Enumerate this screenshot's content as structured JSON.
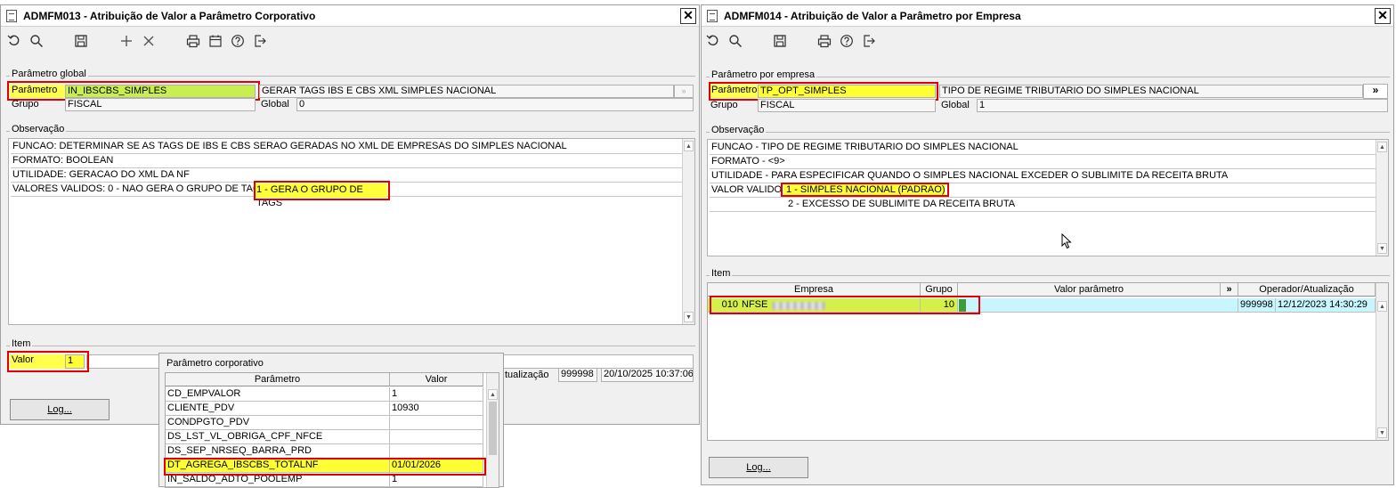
{
  "left_window": {
    "title": "ADMFM013 - Atribuição de Valor a Parâmetro Corporativo",
    "close_label": "✕",
    "param_group": {
      "title": "Parâmetro global",
      "param_label": "Parâmetro",
      "param_value": "IN_IBSCBS_SIMPLES",
      "param_desc": "GERAR TAGS IBS E CBS XML SIMPLES NACIONAL",
      "grupo_label": "Grupo",
      "grupo_value": "FISCAL",
      "global_label": "Global",
      "global_value": "0"
    },
    "obs_group": {
      "title": "Observação",
      "lines": [
        "FUNCAO: DETERMINAR SE AS TAGS DE IBS E CBS SERAO GERADAS NO XML DE EMPRESAS DO SIMPLES NACIONAL",
        "FORMATO: BOOLEAN",
        "UTILIDADE: GERACAO DO XML DA NF",
        "VALORES VALIDOS: 0 - NAO GERA O GRUPO DE TAGS"
      ],
      "highlight": "1 - GERA O GRUPO DE TAGS"
    },
    "item_group": {
      "title": "Item",
      "valor_label": "Valor",
      "valor_value": "1",
      "atualizacao_label": "tualização",
      "operador_value": "999998",
      "data_value": "20/10/2025 10:37:06"
    },
    "log_button": "Log..."
  },
  "popup": {
    "title": "Parâmetro corporativo",
    "col_param": "Parâmetro",
    "col_valor": "Valor",
    "rows": [
      {
        "param": "CD_EMPVALOR",
        "valor": "1"
      },
      {
        "param": "CLIENTE_PDV",
        "valor": "10930"
      },
      {
        "param": "CONDPGTO_PDV",
        "valor": ""
      },
      {
        "param": "DS_LST_VL_OBRIGA_CPF_NFCE",
        "valor": ""
      },
      {
        "param": "DS_SEP_NRSEQ_BARRA_PRD",
        "valor": ""
      },
      {
        "param": "DT_AGREGA_IBSCBS_TOTALNF",
        "valor": "01/01/2026"
      },
      {
        "param": "IN_SALDO_ADTO_POOLEMP",
        "valor": "1"
      }
    ]
  },
  "right_window": {
    "title": "ADMFM014 - Atribuição de Valor a Parâmetro por Empresa",
    "close_label": "✕",
    "param_group": {
      "title": "Parâmetro por empresa",
      "param_label": "Parâmetro",
      "param_value": "TP_OPT_SIMPLES",
      "param_desc": "TIPO DE REGIME TRIBUTARIO DO SIMPLES NACIONAL",
      "expand_label": "»",
      "grupo_label": "Grupo",
      "grupo_value": "FISCAL",
      "global_label": "Global",
      "global_value": "1"
    },
    "obs_group": {
      "title": "Observação",
      "lines": [
        "FUNCAO - TIPO DE REGIME TRIBUTARIO DO SIMPLES NACIONAL",
        "FORMATO - <9>",
        "UTILIDADE - PARA ESPECIFICAR QUANDO O SIMPLES NACIONAL EXCEDER O SUBLIMITE DA RECEITA BRUTA",
        "VALOR VALIDO",
        "2 - EXCESSO DE SUBLIMITE DA RECEITA BRUTA"
      ],
      "highlight": "1 - SIMPLES NACIONAL (PADRAO)"
    },
    "item_group": {
      "title": "Item",
      "col_empresa": "Empresa",
      "col_grupo": "Grupo",
      "col_valor": "Valor parâmetro",
      "col_expand": "»",
      "col_operador": "Operador/Atualização",
      "row": {
        "codigo": "010",
        "empresa": "NFSE",
        "grupo": "10",
        "valor": "1",
        "operador": "999998",
        "atualizacao": "12/12/2023 14:30:29"
      }
    },
    "log_button": "Log..."
  },
  "colors": {
    "highlight_yellow": "#ffff33",
    "highlight_green": "#c8ee50",
    "annotation_red": "#e00000",
    "row_cyan": "#c8f5ff"
  }
}
